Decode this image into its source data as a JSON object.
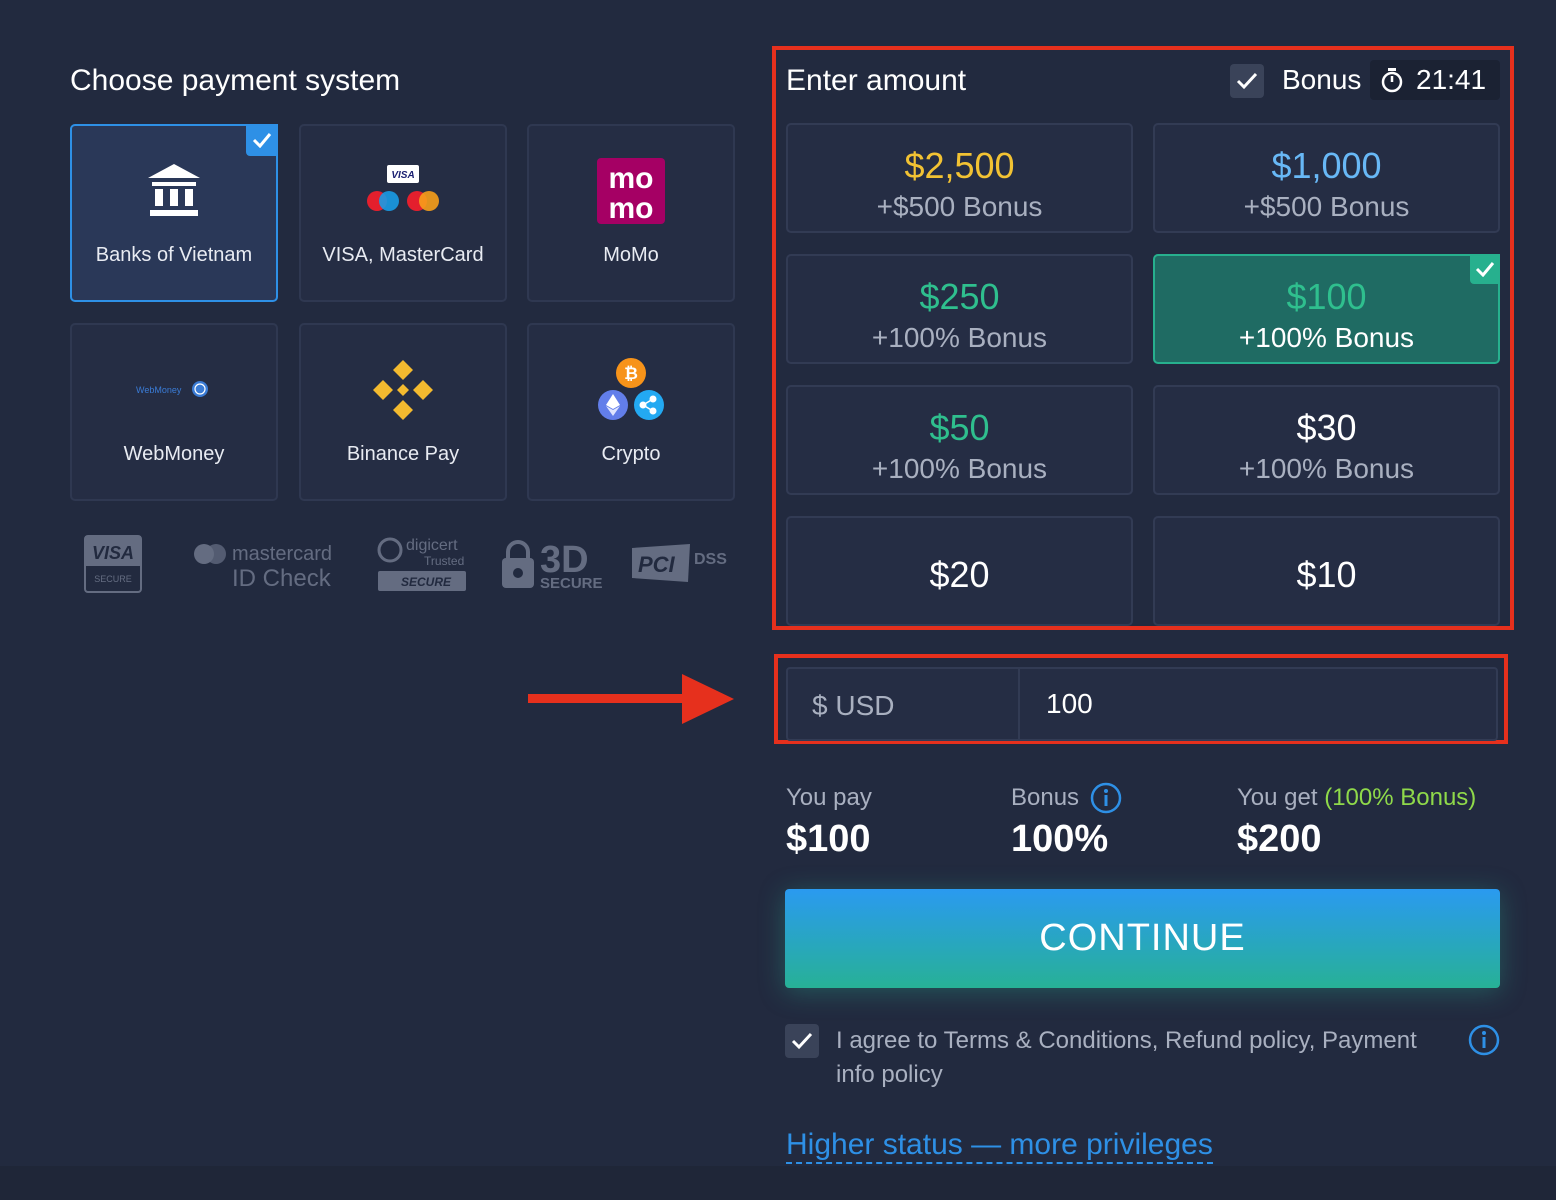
{
  "payment": {
    "title": "Choose payment system",
    "methods": [
      {
        "label": "Banks of Vietnam",
        "selected": true,
        "icon": "bank-icon"
      },
      {
        "label": "VISA, MasterCard",
        "selected": false,
        "icon": "visa-mastercard-icon"
      },
      {
        "label": "MoMo",
        "selected": false,
        "icon": "momo-icon"
      },
      {
        "label": "WebMoney",
        "selected": false,
        "icon": "webmoney-icon"
      },
      {
        "label": "Binance Pay",
        "selected": false,
        "icon": "binance-icon"
      },
      {
        "label": "Crypto",
        "selected": false,
        "icon": "crypto-icon"
      }
    ],
    "logo_text": {
      "momo_top": "mo",
      "momo_bottom": "mo",
      "visa_small": "VISA",
      "webmoney": "WebMoney",
      "bitcoin": "₿"
    },
    "security_badges": {
      "visa": "VISA",
      "visa_sub": "SECURE",
      "mastercard": "mastercard",
      "mastercard_sub": "ID Check",
      "digicert": "digicert",
      "digicert_sub": "Trusted",
      "digicert_secure": "SECURE",
      "three_d": "3D",
      "three_d_sub": "SECURE",
      "pci": "PCI",
      "dss": "DSS"
    }
  },
  "amount": {
    "title": "Enter amount",
    "bonus_label": "Bonus",
    "bonus_checked": true,
    "timer": "21:41",
    "options": [
      {
        "value": "$2,500",
        "bonus": "+$500 Bonus",
        "color": "#f2c233",
        "selected": false
      },
      {
        "value": "$1,000",
        "bonus": "+$500 Bonus",
        "color": "#68b8f6",
        "selected": false
      },
      {
        "value": "$250",
        "bonus": "+100% Bonus",
        "color": "#2fbf8e",
        "selected": false
      },
      {
        "value": "$100",
        "bonus": "+100% Bonus",
        "color": "#2fbf8e",
        "selected": true
      },
      {
        "value": "$50",
        "bonus": "+100% Bonus",
        "color": "#2fbf8e",
        "selected": false
      },
      {
        "value": "$30",
        "bonus": "+100% Bonus",
        "color": "#ffffff",
        "selected": false
      },
      {
        "value": "$20",
        "bonus": "",
        "color": "#ffffff",
        "selected": false
      },
      {
        "value": "$10",
        "bonus": "",
        "color": "#ffffff",
        "selected": false
      }
    ],
    "currency": "$ USD",
    "input_value": "100"
  },
  "summary": {
    "you_pay_label": "You pay",
    "you_pay_value": "$100",
    "bonus_label": "Bonus",
    "bonus_value": "100%",
    "you_get_label": "You get",
    "you_get_bonus": "(100% Bonus)",
    "you_get_value": "$200"
  },
  "continue_label": "CONTINUE",
  "agree": {
    "checked": true,
    "text": "I agree to Terms & Conditions, Refund policy, Payment info policy"
  },
  "higher_status_link": "Higher status — more privileges",
  "colors": {
    "background": "#222a3f",
    "accent_blue": "#2e90e6",
    "accent_green": "#27b08e",
    "highlight_red": "#e6301d",
    "gold": "#f2c233"
  }
}
